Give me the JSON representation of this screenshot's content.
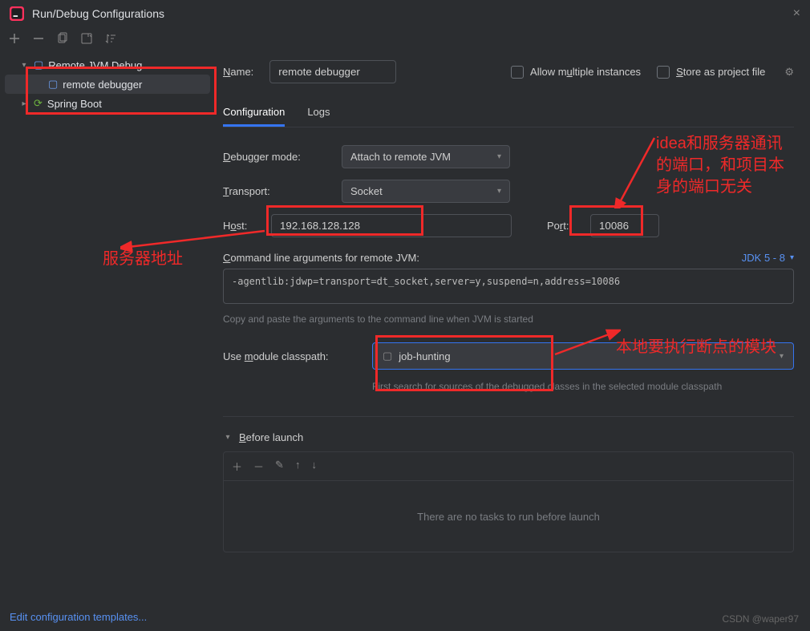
{
  "window": {
    "title": "Run/Debug Configurations"
  },
  "sidebar": {
    "items": [
      {
        "label": "Remote JVM Debug",
        "expanded": true
      },
      {
        "label": "remote debugger",
        "selected": true
      },
      {
        "label": "Spring Boot",
        "expanded": false
      }
    ]
  },
  "header": {
    "name_label": "Name:",
    "name_value": "remote debugger",
    "allow_multiple": "Allow multiple instances",
    "store_as_project": "Store as project file"
  },
  "tabs": {
    "configuration": "Configuration",
    "logs": "Logs"
  },
  "form": {
    "debugger_mode_label": "Debugger mode:",
    "debugger_mode_value": "Attach to remote JVM",
    "transport_label": "Transport:",
    "transport_value": "Socket",
    "host_label": "Host:",
    "host_value": "192.168.128.128",
    "port_label": "Port:",
    "port_value": "10086",
    "cmdline_label": "Command line arguments for remote JVM:",
    "jdk_link": "JDK 5 - 8",
    "cmdline_value": "-agentlib:jdwp=transport=dt_socket,server=y,suspend=n,address=10086",
    "cmdline_hint": "Copy and paste the arguments to the command line when JVM is started",
    "module_label": "Use module classpath:",
    "module_value": "job-hunting",
    "module_hint": "First search for sources of the debugged classes in the selected module classpath"
  },
  "before_launch": {
    "title": "Before launch",
    "empty": "There are no tasks to run before launch"
  },
  "footer": {
    "edit_templates": "Edit configuration templates...",
    "watermark": "CSDN @waper97"
  },
  "annotations": {
    "server_addr": "服务器地址",
    "port_note": "idea和服务器通讯的端口，和项目本身的端口无关",
    "module_note": "本地要执行断点的模块"
  }
}
